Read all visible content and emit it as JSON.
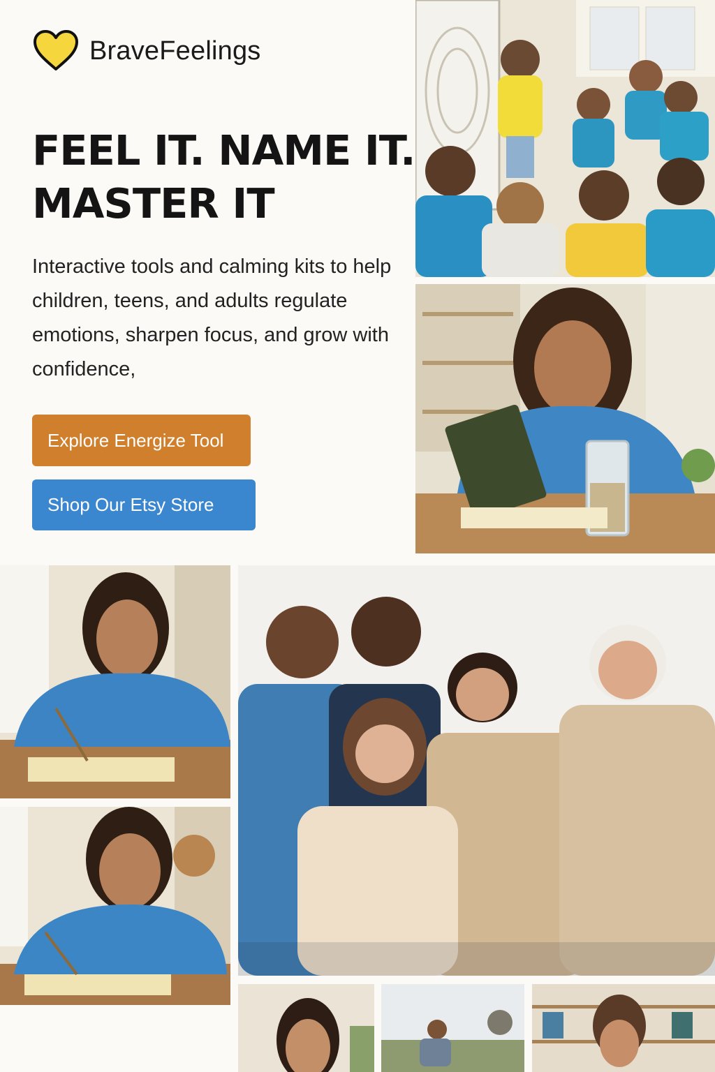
{
  "brand": {
    "name": "BraveFeelings",
    "logo_icon": "heart-icon",
    "logo_color": "#f5d63d"
  },
  "hero": {
    "headline_line1": "FEEL IT. NAME IT.",
    "headline_line2": "MASTER IT",
    "subtext": "Interactive tools and calming kits to help children, teens, and adults regulate emotions, sharpen focus, and grow with confidence,"
  },
  "buttons": {
    "energize_label": "Explore Energize Tool",
    "energize_color": "#d07f2c",
    "etsy_label": "Shop Our Etsy Store",
    "etsy_color": "#3a86cf"
  }
}
